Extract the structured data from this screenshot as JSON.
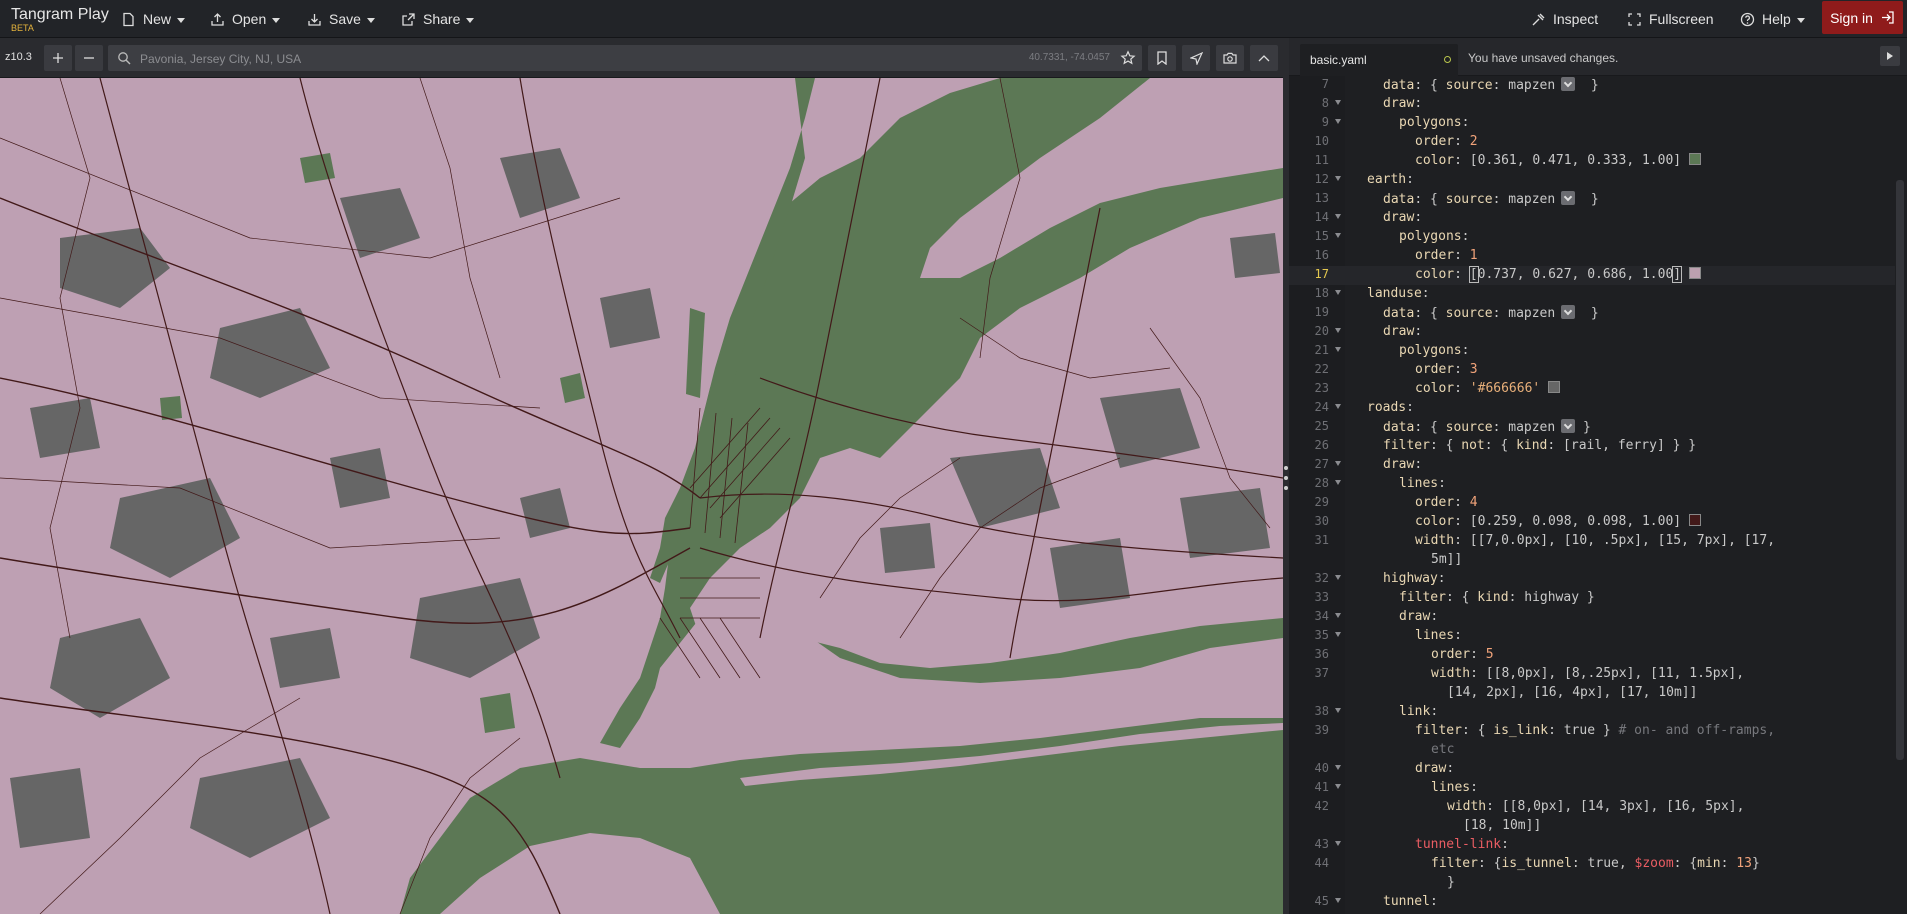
{
  "app": {
    "title": "Tangram Play",
    "badge": "BETA",
    "menu": {
      "new": "New",
      "open": "Open",
      "save": "Save",
      "share": "Share",
      "inspect": "Inspect",
      "fullscreen": "Fullscreen",
      "help": "Help",
      "signin": "Sign in"
    }
  },
  "map": {
    "zoom": "z10.3",
    "search": {
      "placeholder": "Pavonia, Jersey City, NJ, USA",
      "coords": "40.7331, -74.0457"
    },
    "colors": {
      "earth": "#bca0af",
      "water": "#5c7855",
      "landuse": "#666666",
      "roads": "#421919"
    }
  },
  "editor": {
    "tab": "basic.yaml",
    "unsaved": "You have unsaved changes.",
    "active_line": 17,
    "lines": [
      {
        "n": "7",
        "fold": false,
        "indent": 4,
        "html": "<span class='k'>data</span><span class='p'>: { </span><span class='k'>source</span><span class='p'>: mapzen</span><span class='widget' data-name='source-picker-widget' data-interactable='true'></span><span class='p'>  }</span>"
      },
      {
        "n": "8",
        "fold": true,
        "indent": 4,
        "html": "<span class='k'>draw</span><span class='p'>:</span>"
      },
      {
        "n": "9",
        "fold": true,
        "indent": 6,
        "html": "<span class='k'>polygons</span><span class='p'>:</span>"
      },
      {
        "n": "10",
        "fold": false,
        "indent": 8,
        "html": "<span class='k'>order</span><span class='p'>: </span><span class='n'>2</span>"
      },
      {
        "n": "11",
        "fold": false,
        "indent": 8,
        "html": "<span class='k'>color</span><span class='p'>: [0.361, 0.471, 0.333, 1.00]</span><span class='swatch' style='background:#5c7855' data-name='color-swatch' data-interactable='true'></span>"
      },
      {
        "n": "12",
        "fold": true,
        "indent": 2,
        "html": "<span class='k'>earth</span><span class='p'>:</span>"
      },
      {
        "n": "13",
        "fold": false,
        "indent": 4,
        "html": "<span class='k'>data</span><span class='p'>: { </span><span class='k'>source</span><span class='p'>: mapzen</span><span class='widget' data-name='source-picker-widget' data-interactable='true'></span><span class='p'>  }</span>"
      },
      {
        "n": "14",
        "fold": true,
        "indent": 4,
        "html": "<span class='k'>draw</span><span class='p'>:</span>"
      },
      {
        "n": "15",
        "fold": true,
        "indent": 6,
        "html": "<span class='k'>polygons</span><span class='p'>:</span>"
      },
      {
        "n": "16",
        "fold": false,
        "indent": 8,
        "html": "<span class='k'>order</span><span class='p'>: </span><span class='n'>1</span>"
      },
      {
        "n": "17",
        "fold": false,
        "indent": 8,
        "html": "<span class='k'>color</span><span class='p'>: </span><span class='p cursor-bracket'>[</span><span class='p'>0.737, 0.627, 0.686, 1.00</span><span class='p cursor-bracket'>]</span><span class='swatch' style='background:#bca0af' data-name='color-swatch' data-interactable='true'></span>"
      },
      {
        "n": "18",
        "fold": true,
        "indent": 2,
        "html": "<span class='k'>landuse</span><span class='p'>:</span>"
      },
      {
        "n": "19",
        "fold": false,
        "indent": 4,
        "html": "<span class='k'>data</span><span class='p'>: { </span><span class='k'>source</span><span class='p'>: mapzen</span><span class='widget' data-name='source-picker-widget' data-interactable='true'></span><span class='p'>  }</span>"
      },
      {
        "n": "20",
        "fold": true,
        "indent": 4,
        "html": "<span class='k'>draw</span><span class='p'>:</span>"
      },
      {
        "n": "21",
        "fold": true,
        "indent": 6,
        "html": "<span class='k'>polygons</span><span class='p'>:</span>"
      },
      {
        "n": "22",
        "fold": false,
        "indent": 8,
        "html": "<span class='k'>order</span><span class='p'>: </span><span class='n'>3</span>"
      },
      {
        "n": "23",
        "fold": false,
        "indent": 8,
        "html": "<span class='k'>color</span><span class='p'>: </span><span class='s'>'#666666'</span><span class='swatch' style='background:#666666' data-name='color-swatch' data-interactable='true'></span>"
      },
      {
        "n": "24",
        "fold": true,
        "indent": 2,
        "html": "<span class='k'>roads</span><span class='p'>:</span>"
      },
      {
        "n": "25",
        "fold": false,
        "indent": 4,
        "html": "<span class='k'>data</span><span class='p'>: { </span><span class='k'>source</span><span class='p'>: mapzen</span><span class='widget' data-name='source-picker-widget' data-interactable='true'></span><span class='p'> }</span>"
      },
      {
        "n": "26",
        "fold": false,
        "indent": 4,
        "html": "<span class='k'>filter</span><span class='p'>: { </span><span class='k'>not</span><span class='p'>: { </span><span class='k'>kind</span><span class='p'>: [rail, ferry] } }</span>"
      },
      {
        "n": "27",
        "fold": true,
        "indent": 4,
        "html": "<span class='k'>draw</span><span class='p'>:</span>"
      },
      {
        "n": "28",
        "fold": true,
        "indent": 6,
        "html": "<span class='k'>lines</span><span class='p'>:</span>"
      },
      {
        "n": "29",
        "fold": false,
        "indent": 8,
        "html": "<span class='k'>order</span><span class='p'>: </span><span class='n'>4</span>"
      },
      {
        "n": "30",
        "fold": false,
        "indent": 8,
        "html": "<span class='k'>color</span><span class='p'>: [0.259, 0.098, 0.098, 1.00]</span><span class='swatch' style='background:#421919' data-name='color-swatch' data-interactable='true'></span>"
      },
      {
        "n": "31",
        "fold": false,
        "indent": 8,
        "html": "<span class='k'>width</span><span class='p'>: [[7,0.0px], [10, .5px], [15, 7px], [17,</span>"
      },
      {
        "n": "",
        "fold": false,
        "indent": 10,
        "html": "<span class='p'>5m]]</span>"
      },
      {
        "n": "32",
        "fold": true,
        "indent": 4,
        "html": "<span class='k'>highway</span><span class='p'>:</span>"
      },
      {
        "n": "33",
        "fold": false,
        "indent": 6,
        "html": "<span class='k'>filter</span><span class='p'>: { </span><span class='k'>kind</span><span class='p'>: highway }</span>"
      },
      {
        "n": "34",
        "fold": true,
        "indent": 6,
        "html": "<span class='k'>draw</span><span class='p'>:</span>"
      },
      {
        "n": "35",
        "fold": true,
        "indent": 8,
        "html": "<span class='k'>lines</span><span class='p'>:</span>"
      },
      {
        "n": "36",
        "fold": false,
        "indent": 10,
        "html": "<span class='k'>order</span><span class='p'>: </span><span class='n'>5</span>"
      },
      {
        "n": "37",
        "fold": false,
        "indent": 10,
        "html": "<span class='k'>width</span><span class='p'>: [[8,0px], [8,.25px], [11, 1.5px],</span>"
      },
      {
        "n": "",
        "fold": false,
        "indent": 12,
        "html": "<span class='p'>[14, 2px], [16, 4px], [17, 10m]]</span>"
      },
      {
        "n": "38",
        "fold": true,
        "indent": 6,
        "html": "<span class='k'>link</span><span class='p'>:</span>"
      },
      {
        "n": "39",
        "fold": false,
        "indent": 8,
        "html": "<span class='k'>filter</span><span class='p'>: { </span><span class='k'>is_link</span><span class='p'>: true } </span><span class='c'># on- and off-ramps,</span>"
      },
      {
        "n": "",
        "fold": false,
        "indent": 10,
        "html": "<span class='c'>etc</span>"
      },
      {
        "n": "40",
        "fold": true,
        "indent": 8,
        "html": "<span class='k'>draw</span><span class='p'>:</span>"
      },
      {
        "n": "41",
        "fold": true,
        "indent": 10,
        "html": "<span class='k'>lines</span><span class='p'>:</span>"
      },
      {
        "n": "42",
        "fold": false,
        "indent": 12,
        "html": "<span class='k'>width</span><span class='p'>: [[8,0px], [14, 3px], [16, 5px],</span>"
      },
      {
        "n": "",
        "fold": false,
        "indent": 14,
        "html": "<span class='p'>[18, 10m]]</span>"
      },
      {
        "n": "43",
        "fold": true,
        "indent": 8,
        "html": "<span class='v'>tunnel-link</span><span class='p'>:</span>"
      },
      {
        "n": "44",
        "fold": false,
        "indent": 10,
        "html": "<span class='k'>filter</span><span class='p'>: {</span><span class='k'>is_tunnel</span><span class='p'>: true, </span><span class='v'>$zoom</span><span class='p'>: {</span><span class='k'>min</span><span class='p'>: </span><span class='n'>13</span><span class='p'>}</span>"
      },
      {
        "n": "",
        "fold": false,
        "indent": 12,
        "html": "<span class='p'>}</span>"
      },
      {
        "n": "45",
        "fold": true,
        "indent": 4,
        "html": "<span class='k'>tunnel</span><span class='p'>:</span>"
      }
    ]
  }
}
